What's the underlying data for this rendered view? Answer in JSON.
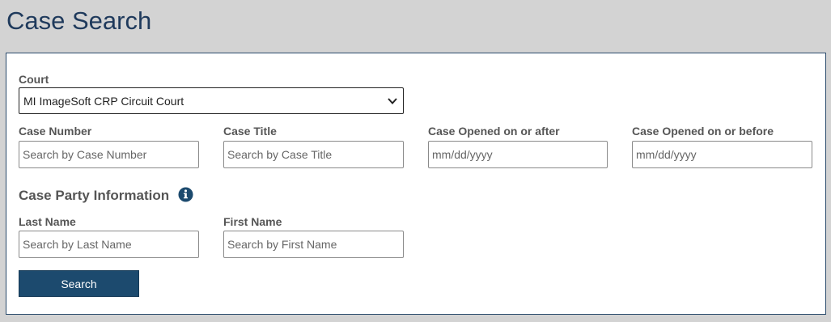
{
  "page": {
    "title": "Case Search"
  },
  "form": {
    "court": {
      "label": "Court",
      "value": "MI ImageSoft CRP Circuit Court"
    },
    "case_number": {
      "label": "Case Number",
      "placeholder": "Search by Case Number"
    },
    "case_title": {
      "label": "Case Title",
      "placeholder": "Search by Case Title"
    },
    "opened_after": {
      "label": "Case Opened on or after",
      "placeholder": "mm/dd/yyyy"
    },
    "opened_before": {
      "label": "Case Opened on or before",
      "placeholder": "mm/dd/yyyy"
    },
    "party_section": {
      "heading": "Case Party Information",
      "icon": "info-icon"
    },
    "last_name": {
      "label": "Last Name",
      "placeholder": "Search by Last Name"
    },
    "first_name": {
      "label": "First Name",
      "placeholder": "Search by First Name"
    },
    "search_button": {
      "label": "Search"
    }
  },
  "colors": {
    "background": "#d3d3d3",
    "title": "#1f3a5c",
    "button": "#1c4a6e",
    "panel_border": "#2a4a6b"
  }
}
